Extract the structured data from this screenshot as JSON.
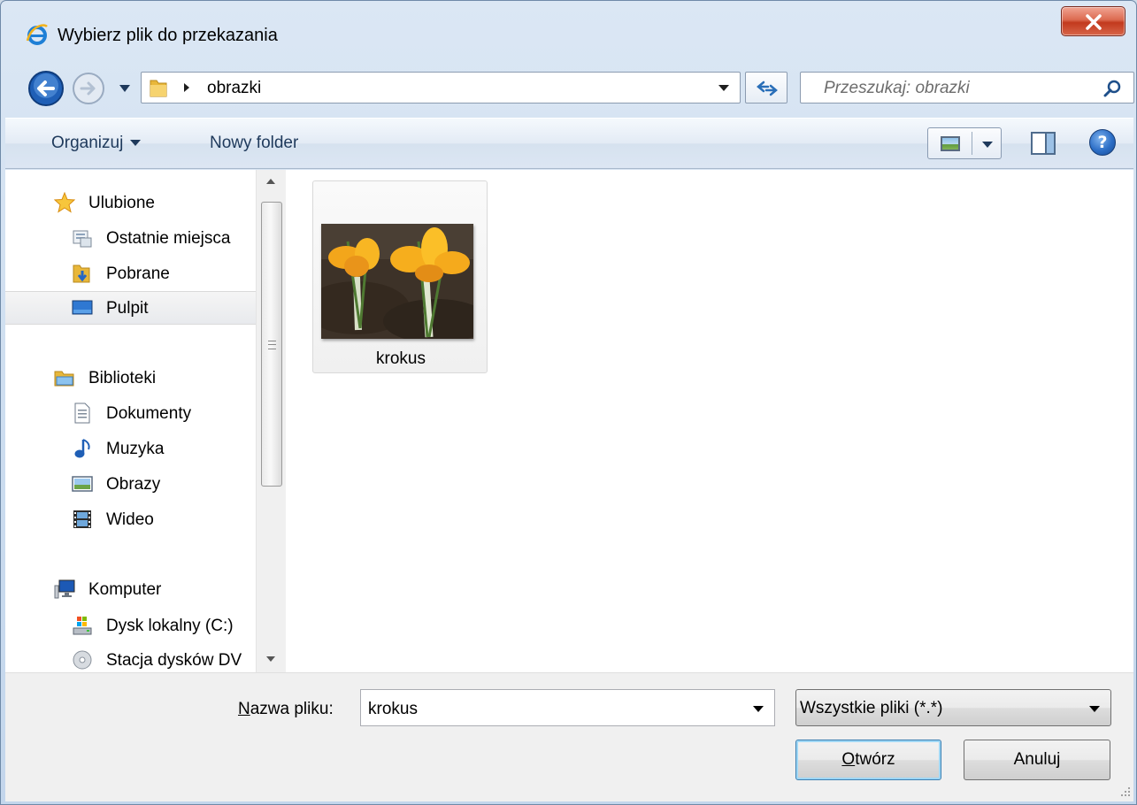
{
  "window": {
    "title": "Wybierz plik do przekazania",
    "close_label": "x"
  },
  "address": {
    "path": "obrazki",
    "search_placeholder": "Przeszukaj: obrazki"
  },
  "commands": {
    "organize": "Organizuj",
    "new_folder": "Nowy folder",
    "help": "?"
  },
  "nav": {
    "items": [
      {
        "label": "Ulubione",
        "icon": "star-icon"
      },
      {
        "label": "Ostatnie miejsca",
        "icon": "recent-places-icon"
      },
      {
        "label": "Pobrane",
        "icon": "downloads-folder-icon"
      },
      {
        "label": "Pulpit",
        "icon": "desktop-icon"
      },
      {
        "label": "Biblioteki",
        "icon": "libraries-icon"
      },
      {
        "label": "Dokumenty",
        "icon": "documents-icon"
      },
      {
        "label": "Muzyka",
        "icon": "music-note-icon"
      },
      {
        "label": "Obrazy",
        "icon": "pictures-icon"
      },
      {
        "label": "Wideo",
        "icon": "video-film-icon"
      },
      {
        "label": "Komputer",
        "icon": "computer-icon"
      },
      {
        "label": "Dysk lokalny (C:)",
        "icon": "local-disk-icon"
      },
      {
        "label": "Stacja dysków DV",
        "icon": "dvd-drive-icon"
      }
    ],
    "selected": "Pulpit"
  },
  "files": [
    {
      "name": "krokus",
      "icon": "crocus-photo-thumbnail"
    }
  ],
  "footer": {
    "filename_label_prefix": "N",
    "filename_label_rest": "azwa pliku:",
    "filename_value": "krokus",
    "filter_value": "Wszystkie pliki (*.*)",
    "open_prefix": "O",
    "open_rest": "twórz",
    "cancel_label": "Anuluj"
  },
  "colors": {
    "close_button": "#c2391d",
    "link_text": "#1e395b",
    "selection": "#e8eaed"
  }
}
